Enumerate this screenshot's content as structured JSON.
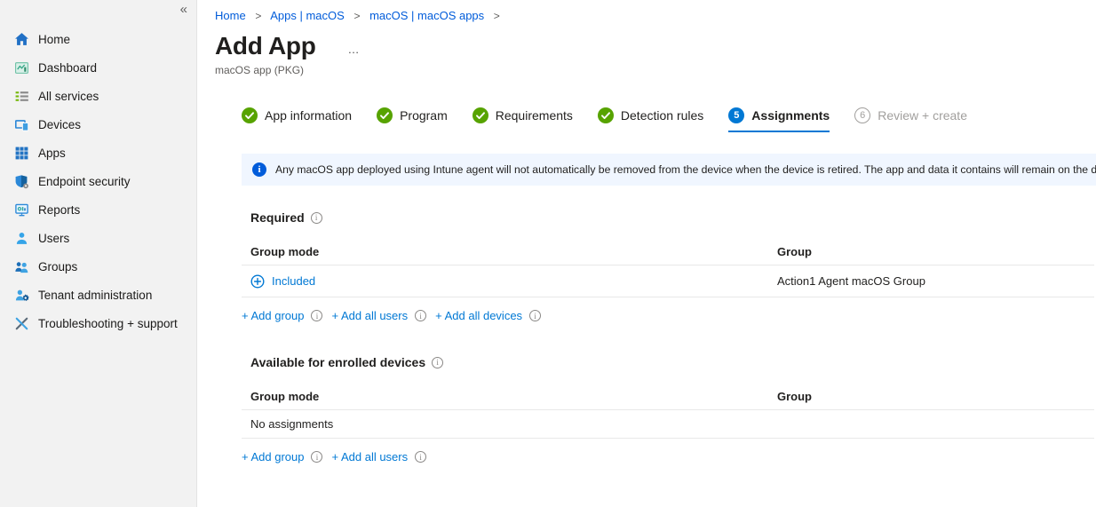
{
  "icons": {
    "collapse_glyph": "«",
    "ellipsis_glyph": "…",
    "info_glyph": "i"
  },
  "sidebar": {
    "items": [
      {
        "label": "Home"
      },
      {
        "label": "Dashboard"
      },
      {
        "label": "All services"
      },
      {
        "label": "Devices"
      },
      {
        "label": "Apps"
      },
      {
        "label": "Endpoint security"
      },
      {
        "label": "Reports"
      },
      {
        "label": "Users"
      },
      {
        "label": "Groups"
      },
      {
        "label": "Tenant administration"
      },
      {
        "label": "Troubleshooting + support"
      }
    ]
  },
  "breadcrumb": {
    "separator": ">",
    "items": [
      "Home",
      "Apps | macOS",
      "macOS | macOS apps"
    ]
  },
  "header": {
    "title": "Add App",
    "subtitle": "macOS app (PKG)"
  },
  "wizard": {
    "steps": [
      {
        "label": "App information",
        "state": "complete"
      },
      {
        "label": "Program",
        "state": "complete"
      },
      {
        "label": "Requirements",
        "state": "complete"
      },
      {
        "label": "Detection rules",
        "state": "complete"
      },
      {
        "label": "Assignments",
        "state": "active",
        "number": "5"
      },
      {
        "label": "Review + create",
        "state": "pending",
        "number": "6"
      }
    ]
  },
  "banner": {
    "text": "Any macOS app deployed using Intune agent will not automatically be removed from the device when the device is retired. The app and data it contains will remain on the device."
  },
  "required_section": {
    "title": "Required",
    "columns": [
      "Group mode",
      "Group"
    ],
    "rows": [
      {
        "group_mode": "Included",
        "group": "Action1 Agent macOS Group"
      }
    ],
    "links": [
      "+ Add group",
      "+ Add all users",
      "+ Add all devices"
    ]
  },
  "available_section": {
    "title": "Available for enrolled devices",
    "columns": [
      "Group mode",
      "Group"
    ],
    "empty_text": "No assignments",
    "links": [
      "+ Add group",
      "+ Add all users"
    ]
  },
  "colors": {
    "breadcrumb_link": "#015cda",
    "action_link": "#0078d4",
    "active_step": "#0078d4",
    "complete_step": "#57a300",
    "banner_bg": "#f0f6ff",
    "sidebar_bg": "#f2f2f2"
  }
}
